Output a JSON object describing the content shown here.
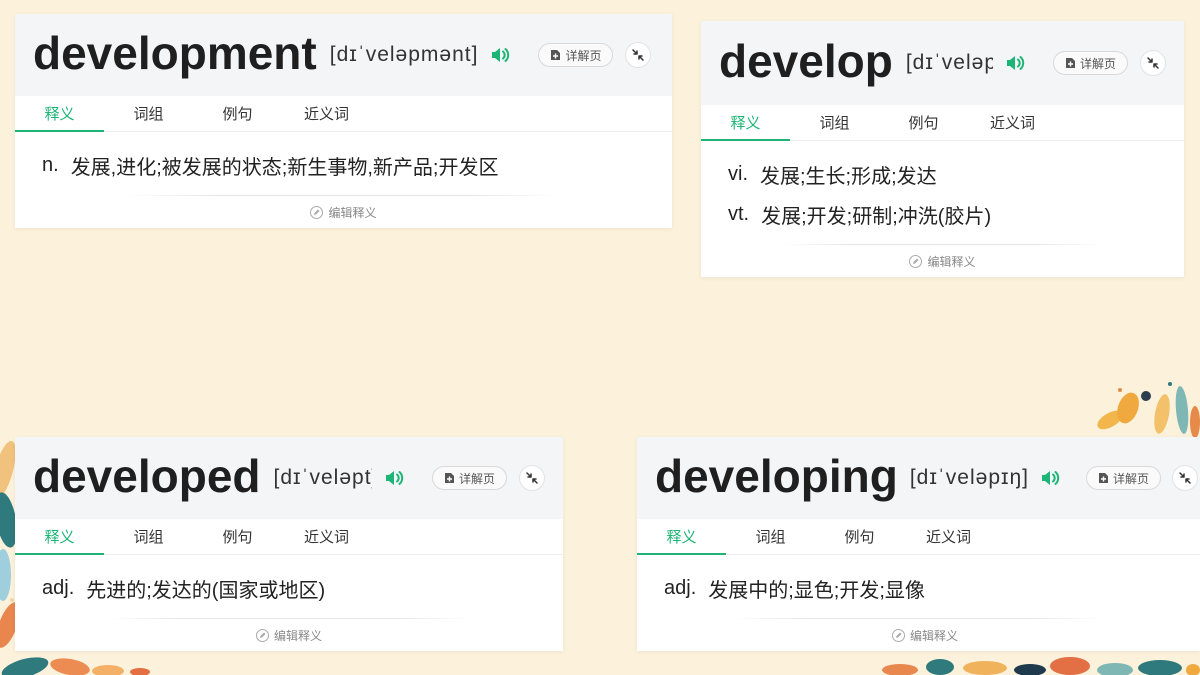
{
  "colors": {
    "accent": "#1db575",
    "background": "#fcf2dc",
    "header_background": "#f4f5f7",
    "text": "#222222"
  },
  "icons": {
    "speaker": "speaker-icon",
    "detail": "add-document-icon",
    "collapse": "collapse-icon",
    "edit": "pencil-icon"
  },
  "cards": [
    {
      "word": "development",
      "phonetic": "[dɪˈveləpmənt]",
      "detail_button": "详解页",
      "tabs": [
        {
          "label": "释义",
          "active": true
        },
        {
          "label": "词组",
          "active": false
        },
        {
          "label": "例句",
          "active": false
        },
        {
          "label": "近义词",
          "active": false
        }
      ],
      "definitions": [
        {
          "pos": "n.",
          "meaning": "发展,进化;被发展的状态;新生事物,新产品;开发区"
        }
      ],
      "edit_label": "编辑释义"
    },
    {
      "word": "develop",
      "phonetic": "[dɪˈveləp]",
      "detail_button": "详解页",
      "tabs": [
        {
          "label": "释义",
          "active": true
        },
        {
          "label": "词组",
          "active": false
        },
        {
          "label": "例句",
          "active": false
        },
        {
          "label": "近义词",
          "active": false
        }
      ],
      "definitions": [
        {
          "pos": "vi.",
          "meaning": "发展;生长;形成;发达"
        },
        {
          "pos": "vt.",
          "meaning": "发展;开发;研制;冲洗(胶片)"
        }
      ],
      "edit_label": "编辑释义"
    },
    {
      "word": "developed",
      "phonetic": "[dɪˈveləpt]",
      "detail_button": "详解页",
      "tabs": [
        {
          "label": "释义",
          "active": true
        },
        {
          "label": "词组",
          "active": false
        },
        {
          "label": "例句",
          "active": false
        },
        {
          "label": "近义词",
          "active": false
        }
      ],
      "definitions": [
        {
          "pos": "adj.",
          "meaning": "先进的;发达的(国家或地区)"
        }
      ],
      "edit_label": "编辑释义"
    },
    {
      "word": "developing",
      "phonetic": "[dɪˈveləpɪŋ]",
      "detail_button": "详解页",
      "tabs": [
        {
          "label": "释义",
          "active": true
        },
        {
          "label": "词组",
          "active": false
        },
        {
          "label": "例句",
          "active": false
        },
        {
          "label": "近义词",
          "active": false
        }
      ],
      "definitions": [
        {
          "pos": "adj.",
          "meaning": "发展中的;显色;开发;显像"
        }
      ],
      "edit_label": "编辑释义"
    }
  ]
}
